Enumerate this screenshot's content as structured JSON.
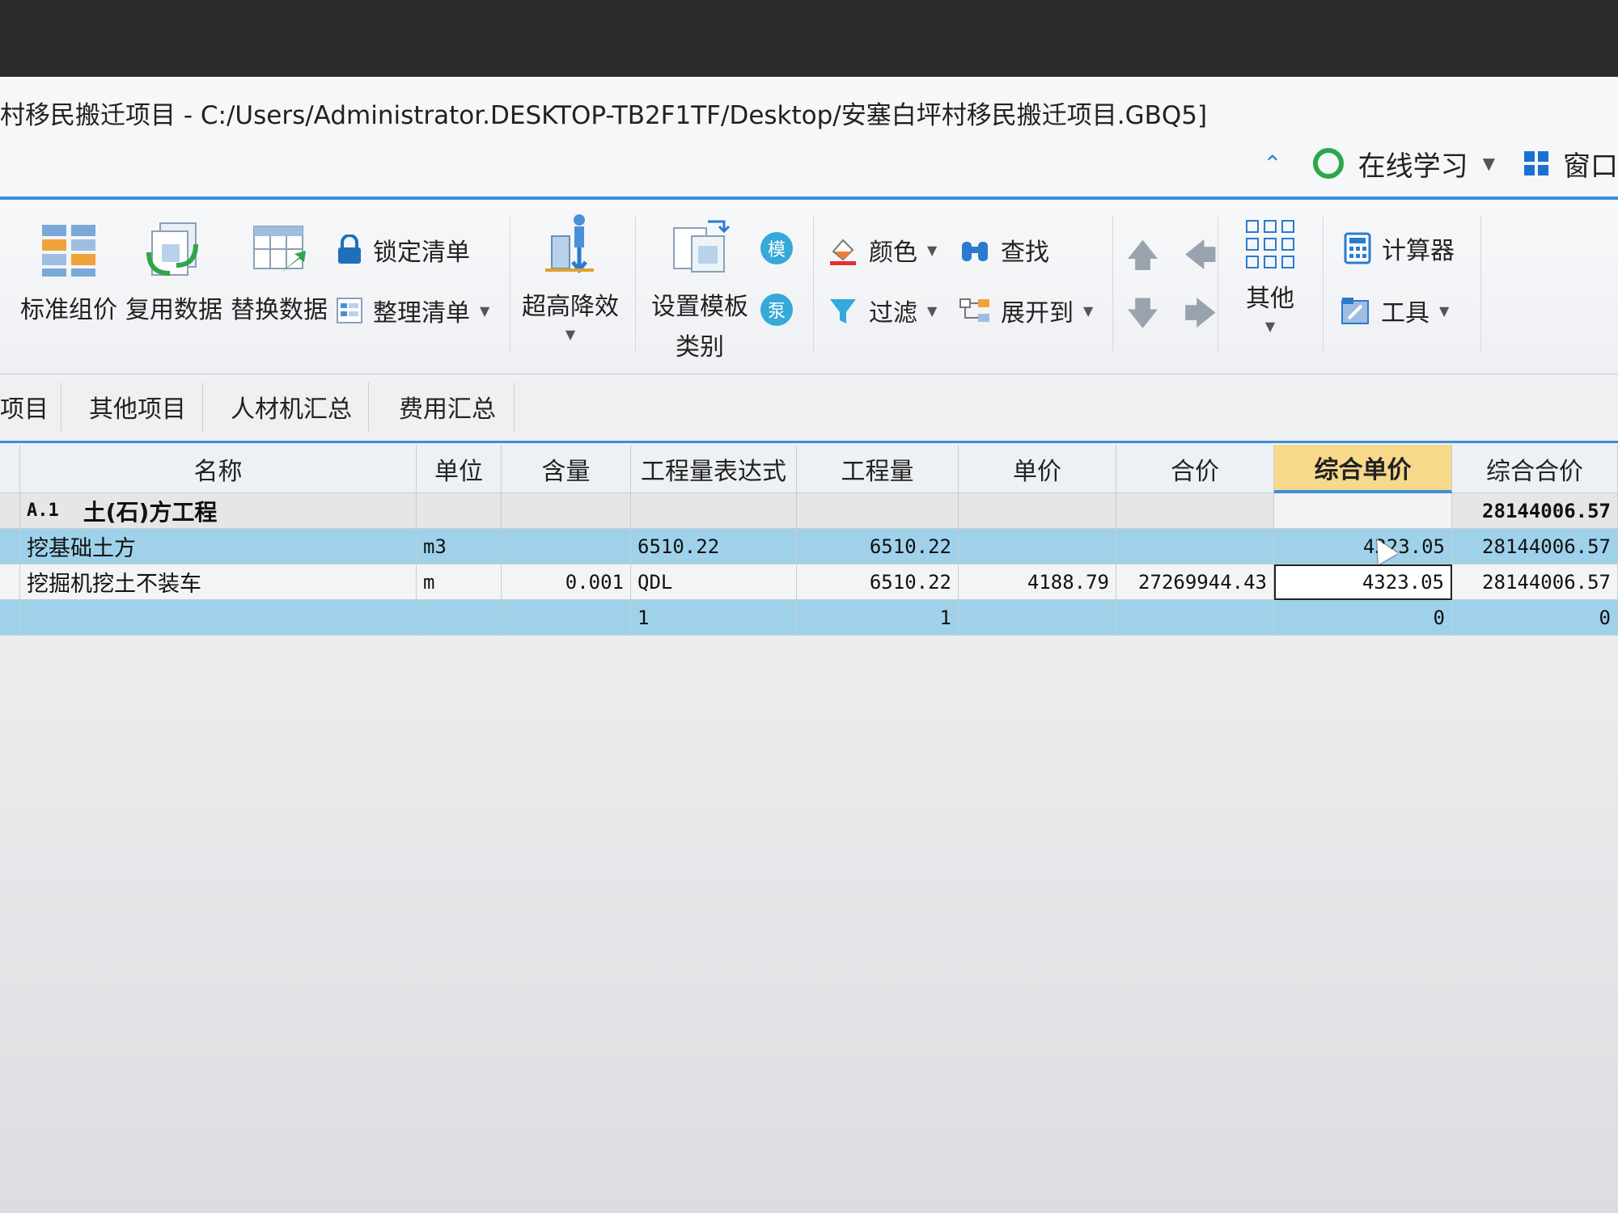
{
  "window": {
    "title": "村移民搬迁项目 - C:/Users/Administrator.DESKTOP-TB2F1TF/Desktop/安塞白坪村移民搬迁项目.GBQ5]",
    "online_learning": "在线学习",
    "window_menu": "窗口"
  },
  "ribbon": {
    "standard_price": "标准组价",
    "reuse_data": "复用数据",
    "replace_data": "替换数据",
    "lock_list": "锁定清单",
    "organize_list": "整理清单",
    "super_high": "超高降效",
    "set_template_line1": "设置模板",
    "set_template_line2": "类别",
    "color": "颜色",
    "find": "查找",
    "filter": "过滤",
    "expand_to": "展开到",
    "other": "其他",
    "calculator": "计算器",
    "tools": "工具",
    "template_badge": "模",
    "pump_badge": "泵"
  },
  "tabs": [
    "项目",
    "其他项目",
    "人材机汇总",
    "费用汇总"
  ],
  "table": {
    "columns": [
      "名称",
      "单位",
      "含量",
      "工程量表达式",
      "工程量",
      "单价",
      "合价",
      "综合单价",
      "综合合价"
    ],
    "rows": [
      {
        "code": "A.1",
        "name": "土(石)方工程",
        "unit": "",
        "content": "",
        "expr": "",
        "qty": "",
        "price": "",
        "total": "",
        "unit_price": "",
        "sum": "28144006.57"
      },
      {
        "code": "",
        "name": "挖基础土方",
        "unit": "m3",
        "content": "",
        "expr": "6510.22",
        "qty": "6510.22",
        "price": "",
        "total": "",
        "unit_price": "4323.05",
        "sum": "28144006.57"
      },
      {
        "code": "",
        "name": "挖掘机挖土不装车",
        "unit": "m",
        "content": "0.001",
        "expr": "QDL",
        "qty": "6510.22",
        "price": "4188.79",
        "total": "27269944.43",
        "unit_price": "4323.05",
        "sum": "28144006.57"
      },
      {
        "code": "",
        "name": "",
        "unit": "",
        "content": "",
        "expr": "1",
        "qty": "1",
        "price": "",
        "total": "",
        "unit_price": "0",
        "sum": "0"
      }
    ]
  }
}
